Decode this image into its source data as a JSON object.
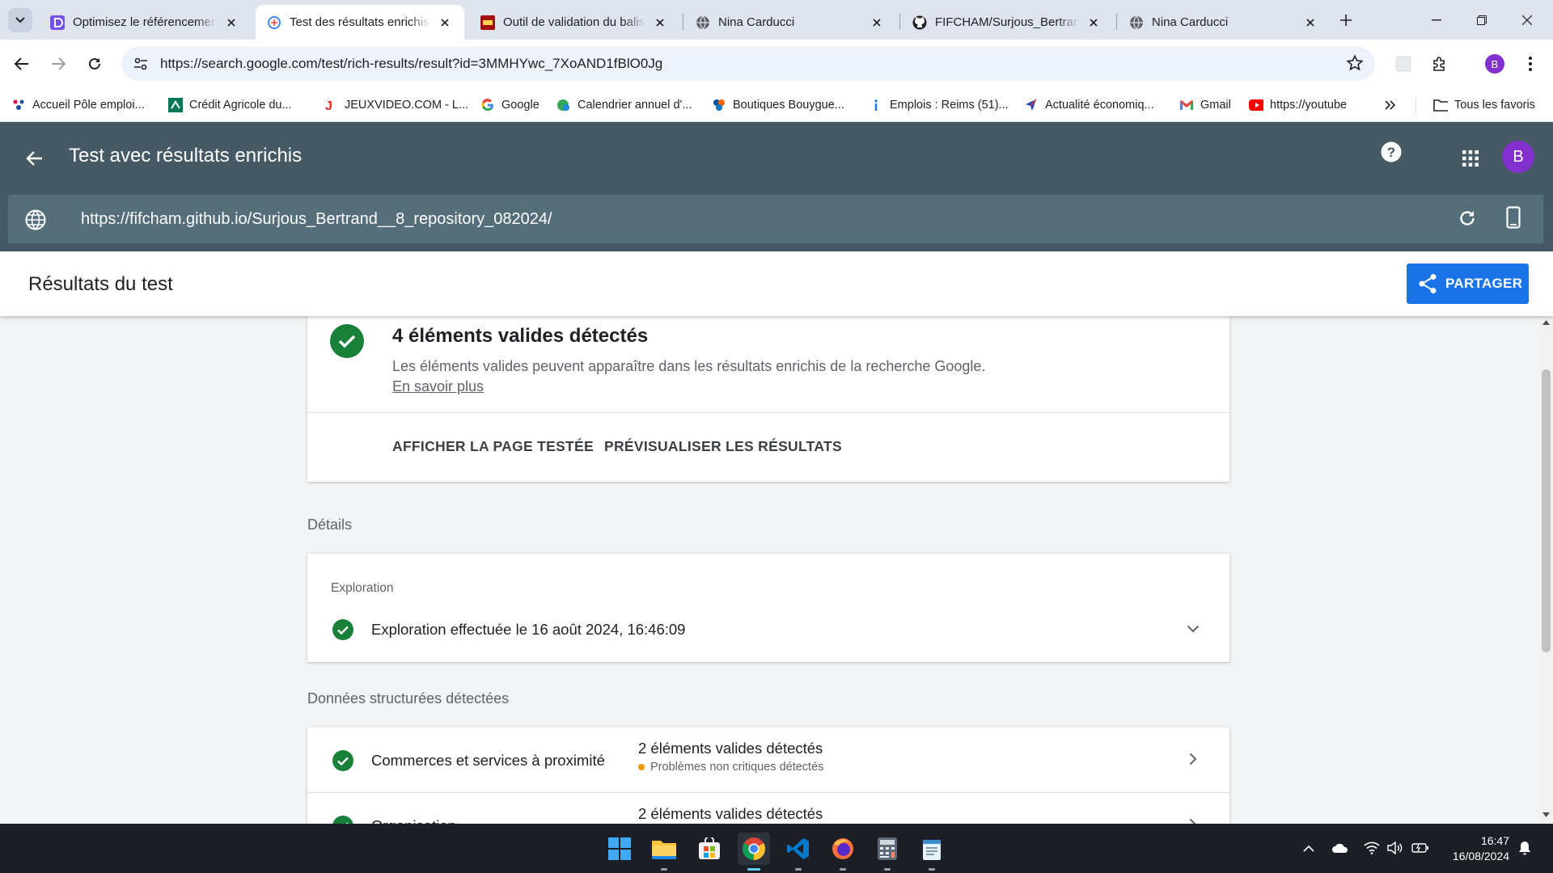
{
  "browser": {
    "tabs": [
      {
        "title": "Optimisez le référencement",
        "favicon": "course-icon"
      },
      {
        "title": "Test des résultats enrichis",
        "favicon": "rich-results-icon",
        "active": true
      },
      {
        "title": "Outil de validation du balisage",
        "favicon": "validator-icon"
      },
      {
        "title": "Nina Carducci",
        "favicon": "globe-icon"
      },
      {
        "title": "FIFCHAM/Surjous_Bertrand",
        "favicon": "github-icon"
      },
      {
        "title": "Nina Carducci",
        "favicon": "globe-icon"
      }
    ],
    "address": "https://search.google.com/test/rich-results/result?id=3MMHYwc_7XoAND1fBlO0Jg",
    "profile_initial": "B",
    "bookmarks": [
      {
        "label": "Accueil Pôle emploi..."
      },
      {
        "label": "Crédit Agricole du..."
      },
      {
        "label": "JEUXVIDEO.COM - L..."
      },
      {
        "label": "Google"
      },
      {
        "label": "Calendrier annuel d'..."
      },
      {
        "label": "Boutiques Bouygue..."
      },
      {
        "label": "Emplois : Reims (51)..."
      },
      {
        "label": "Actualité économiq..."
      },
      {
        "label": "Gmail"
      },
      {
        "label": "https://youtube"
      }
    ],
    "all_bookmarks_label": "Tous les favoris"
  },
  "app": {
    "title": "Test avec résultats enrichis",
    "tested_url": "https://fifcham.github.io/Surjous_Bertrand__8_repository_082024/",
    "avatar_initial": "B",
    "results_title": "Résultats du test",
    "share_label": "PARTAGER",
    "accent_color": "#1a73e8",
    "header_color": "#455a64",
    "success_color": "#188038",
    "warning_color": "#f29900"
  },
  "summary": {
    "heading": "4 éléments valides détectés",
    "description": "Les éléments valides peuvent apparaître dans les résultats enrichis de la recherche Google.",
    "learn_more": "En savoir plus",
    "action_view_page": "AFFICHER LA PAGE TESTÉE",
    "action_preview": "PRÉVISUALISER LES RÉSULTATS"
  },
  "details": {
    "section_label": "Détails",
    "crawl_label": "Exploration",
    "crawl_status": "Exploration effectuée le 16 août 2024, 16:46:09"
  },
  "structured_data": {
    "section_label": "Données structurées détectées",
    "items": [
      {
        "name": "Commerces et services à proximité",
        "count": "2 éléments valides détectés",
        "warning": "Problèmes non critiques détectés"
      },
      {
        "name": "Organisation",
        "count": "2 éléments valides détectés"
      }
    ]
  },
  "taskbar": {
    "time": "16:47",
    "date": "16/08/2024",
    "apps": [
      "windows-start-icon",
      "file-explorer-icon",
      "microsoft-store-icon",
      "chrome-icon",
      "vscode-icon",
      "firefox-icon",
      "calculator-icon",
      "notepad-icon"
    ]
  }
}
